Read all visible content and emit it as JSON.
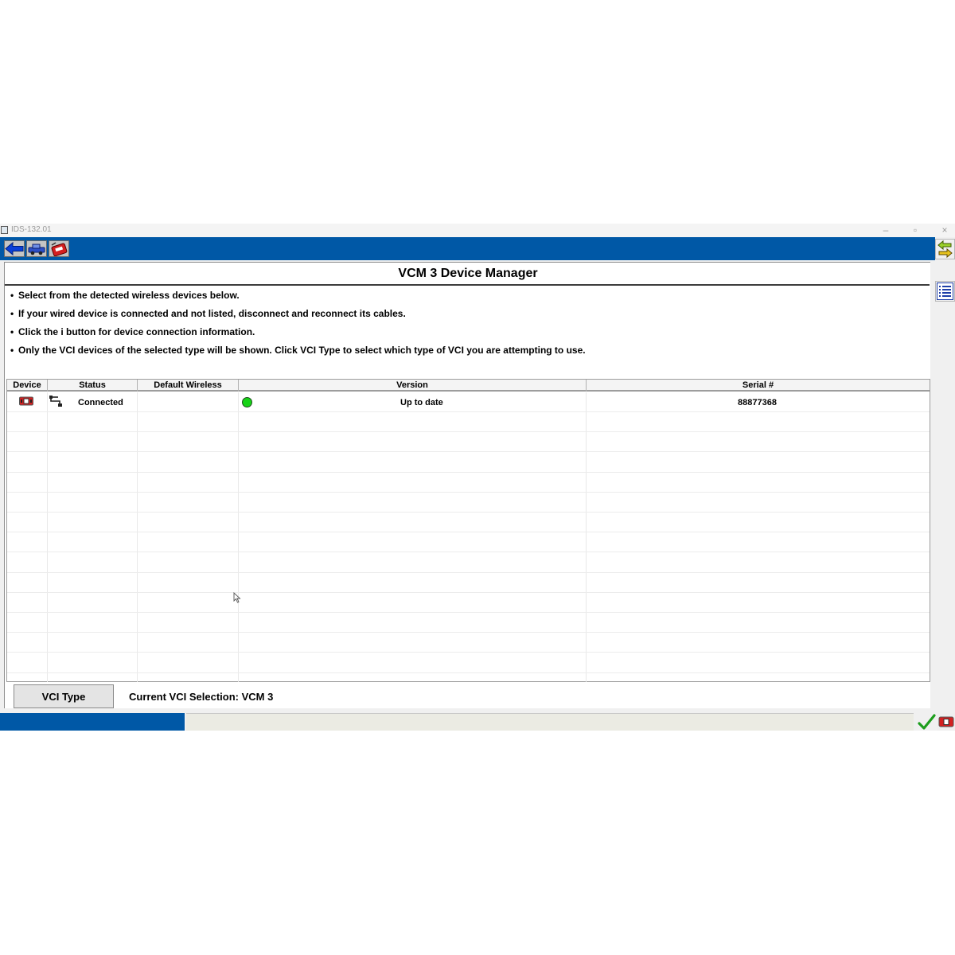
{
  "window": {
    "title": "IDS-132.01",
    "controls": {
      "minimize": "–",
      "restore": "▫",
      "close": "×"
    }
  },
  "toolbar": {
    "icons": [
      "back-arrow-icon",
      "vehicle-icon",
      "toolbox-icon"
    ]
  },
  "page": {
    "title": "VCM 3 Device Manager",
    "instructions": [
      "Select from the detected wireless devices below.",
      "If your wired device is connected and not listed, disconnect and reconnect its cables.",
      "Click the i button for device connection information.",
      "Only the VCI devices of the selected type will be shown. Click VCI Type to select which type of VCI you are attempting to use."
    ]
  },
  "grid": {
    "columns": [
      "Device",
      "Status",
      "Default Wireless",
      "Version",
      "Serial #"
    ],
    "rows": [
      {
        "device_icon": "vcm-device-icon",
        "connection_icon": "wired-connection-icon",
        "status": "Connected",
        "default_wireless": "",
        "version_indicator": "green",
        "version": "Up to date",
        "serial": "88877368"
      }
    ]
  },
  "footer": {
    "vci_type_button": "VCI Type",
    "current_selection": "Current VCI Selection: VCM 3"
  },
  "colors": {
    "toolbar_blue": "#0058a6",
    "status_ok": "#17d317"
  }
}
